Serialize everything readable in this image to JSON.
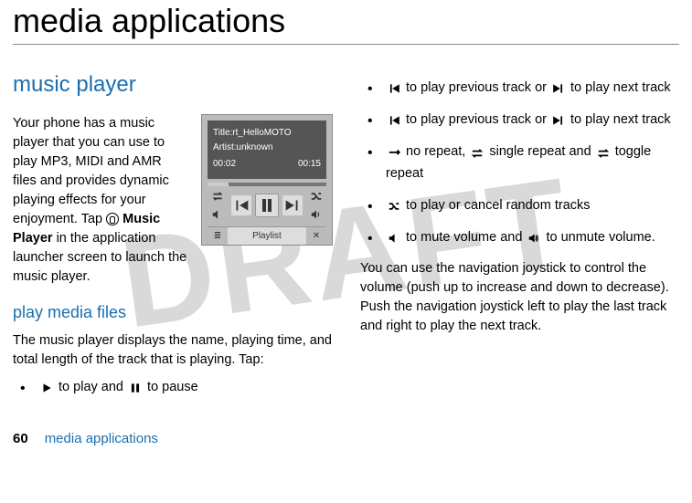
{
  "watermark": "DRAFT",
  "page_title": "media applications",
  "left": {
    "section_heading": "music player",
    "intro_part1": "Your phone has a music player that you can use to play MP3, MIDI and AMR files and provides dynamic playing effects for your enjoyment. Tap ",
    "intro_bold": "Music Player",
    "intro_part2": " in the application launcher screen to launch the music player.",
    "phone": {
      "title_line": "Title:rt_HelloMOTO",
      "artist_line": "Artist:unknown",
      "time_elapsed": "00:02",
      "time_total": "00:15",
      "playlist_label": "Playlist"
    },
    "subsection_heading": "play media files",
    "play_desc": "The music player displays the name, playing time, and total length of the track that is playing. Tap:",
    "bullet_playpause_a": " to play and ",
    "bullet_playpause_b": " to pause"
  },
  "right": {
    "bullet_prevnext_1a": " to play previous track or ",
    "bullet_prevnext_1b": " to play next track",
    "bullet_prevnext_2a": " to play previous track or ",
    "bullet_prevnext_2b": " to play next track",
    "bullet_repeat_a": " no repeat, ",
    "bullet_repeat_b": " single repeat and ",
    "bullet_repeat_c": " toggle repeat",
    "bullet_shuffle": " to play or cancel random tracks",
    "bullet_mute_a": " to mute volume and ",
    "bullet_mute_b": " to unmute volume.",
    "closing": "You can use the navigation joystick to control the volume (push up to increase and down to decrease). Push the navigation joystick left to play the last track and right to play the next track."
  },
  "footer": {
    "page_number": "60",
    "label": "media applications"
  }
}
